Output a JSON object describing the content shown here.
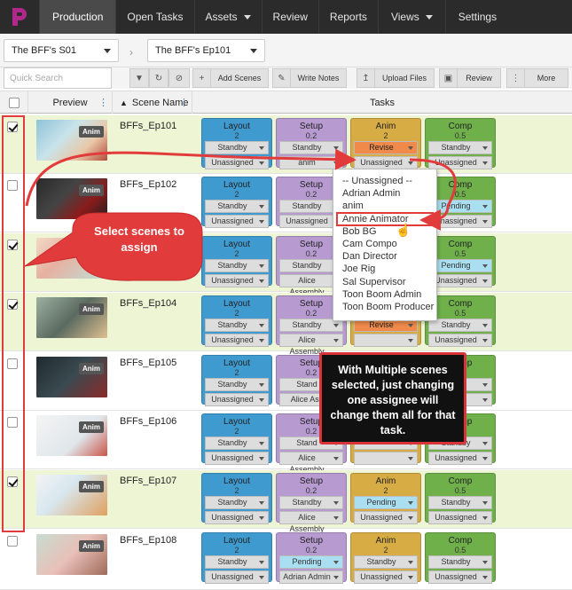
{
  "nav": {
    "items": [
      {
        "label": "Production",
        "active": true
      },
      {
        "label": "Open Tasks"
      },
      {
        "label": "Assets",
        "dropdown": true
      },
      {
        "label": "Review"
      },
      {
        "label": "Reports"
      },
      {
        "label": "Views",
        "dropdown": true
      },
      {
        "label": "Settings"
      }
    ]
  },
  "selectors": {
    "season": "The BFF's S01",
    "episode": "The BFF's Ep101"
  },
  "toolbar": {
    "search_placeholder": "Quick Search",
    "add_scenes": "Add Scenes",
    "write_notes": "Write Notes",
    "upload_files": "Upload Files",
    "review": "Review",
    "more": "More"
  },
  "table": {
    "headers": {
      "preview": "Preview",
      "scene_name": "Scene Name",
      "tasks": "Tasks"
    },
    "task_names": [
      "Layout",
      "Setup",
      "Anim",
      "Comp"
    ],
    "task_versions": [
      "2",
      "0.2",
      "2",
      "0.5"
    ],
    "rows": [
      {
        "scene": "BFFs_Ep101",
        "checked": true,
        "tasks": [
          [
            "Standby",
            "Unassigned"
          ],
          [
            "Standby",
            "anim"
          ],
          [
            "Revise",
            "Unassigned"
          ],
          [
            "Standby",
            "Unassigned"
          ]
        ]
      },
      {
        "scene": "BFFs_Ep102",
        "checked": false,
        "tasks": [
          [
            "Standby",
            "Unassigned"
          ],
          [
            "Standby",
            "Unassigned"
          ],
          [
            "",
            ""
          ],
          [
            "Pending",
            "Unassigned"
          ]
        ]
      },
      {
        "scene": "",
        "checked": true,
        "tasks": [
          [
            "Standby",
            "Unassigned"
          ],
          [
            "Standby",
            "Alice Assembly"
          ],
          [
            "",
            ""
          ],
          [
            "Pending",
            "Unassigned"
          ]
        ]
      },
      {
        "scene": "BFFs_Ep104",
        "checked": true,
        "tasks": [
          [
            "Standby",
            "Unassigned"
          ],
          [
            "Standby",
            "Alice Assembly"
          ],
          [
            "Revise",
            ""
          ],
          [
            "Standby",
            "Unassigned"
          ]
        ]
      },
      {
        "scene": "BFFs_Ep105",
        "checked": false,
        "tasks": [
          [
            "Standby",
            "Unassigned"
          ],
          [
            "Stand",
            "Alice Ass"
          ],
          [
            "",
            ""
          ],
          [
            "",
            ""
          ]
        ]
      },
      {
        "scene": "BFFs_Ep106",
        "checked": false,
        "tasks": [
          [
            "Standby",
            "Unassigned"
          ],
          [
            "Stand",
            "Alice Assembly"
          ],
          [
            "",
            ""
          ],
          [
            "Standby",
            "Unassigned"
          ]
        ]
      },
      {
        "scene": "BFFs_Ep107",
        "checked": true,
        "tasks": [
          [
            "Standby",
            "Unassigned"
          ],
          [
            "Standby",
            "Alice Assembly"
          ],
          [
            "Pending",
            "Unassigned"
          ],
          [
            "Standby",
            "Unassigned"
          ]
        ]
      },
      {
        "scene": "BFFs_Ep108",
        "checked": false,
        "tasks": [
          [
            "Standby",
            "Unassigned"
          ],
          [
            "Pending",
            "Adrian Admin"
          ],
          [
            "Standby",
            "Unassigned"
          ],
          [
            "Standby",
            "Unassigned"
          ]
        ]
      }
    ]
  },
  "thumb_badge": "Anim",
  "assignee_menu": [
    "-- Unassigned --",
    "Adrian Admin",
    "anim",
    "Annie Animator",
    "Bob BG",
    "Cam Compo",
    "Dan Director",
    "Joe Rig",
    "Sal Supervisor",
    "Toon Boom Admin",
    "Toon Boom Producer"
  ],
  "callouts": {
    "select": "Select scenes to assign",
    "multi": "With Multiple scenes selected, just changing one assignee will change them all for that task."
  },
  "colors": {
    "layout": "#3f9ad0",
    "setup": "#b69ad0",
    "anim": "#d7ac44",
    "comp": "#6fb04a",
    "selected_row": "#eef5d4",
    "highlight": "#e23b3b"
  }
}
